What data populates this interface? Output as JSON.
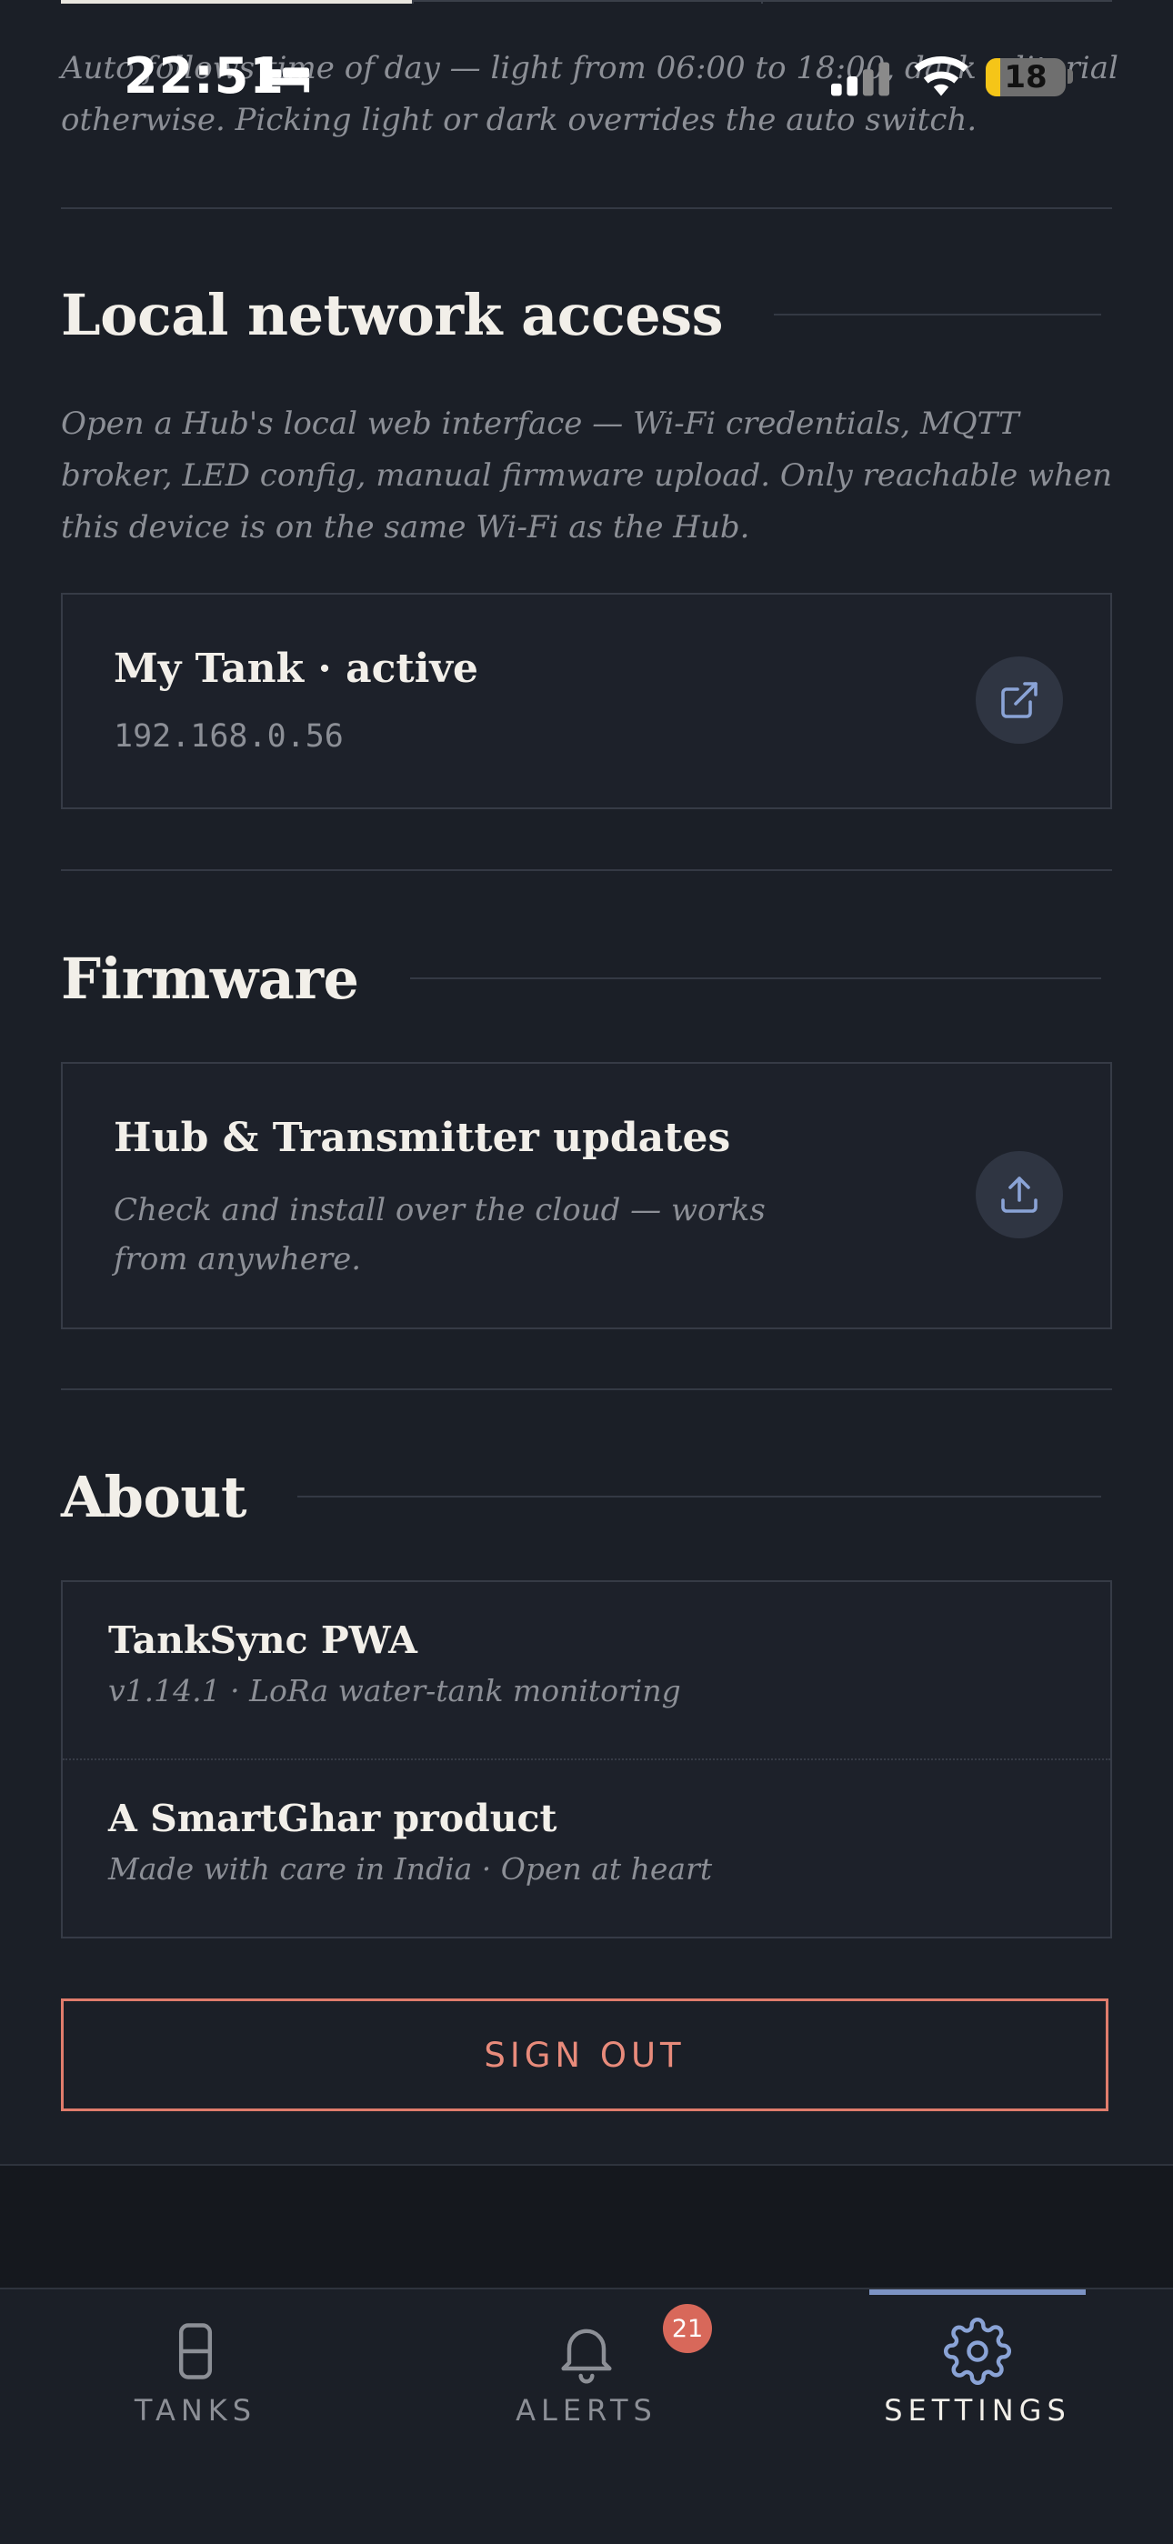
{
  "status_bar": {
    "time": "22:51",
    "battery_level": "18",
    "battery_fraction": 0.18,
    "icons": [
      "bed-icon",
      "cellular-signal-icon",
      "wifi-icon",
      "battery-icon"
    ]
  },
  "theme_note": "Auto follows time of day — light from 06:00 to 18:00, dark editorial otherwise. Picking light or dark overrides the auto switch.",
  "local_network": {
    "heading": "Local network access",
    "description": "Open a Hub's local web interface — Wi-Fi credentials, MQTT broker, LED config, manual firmware upload. Only reachable when this device is on the same Wi-Fi as the Hub.",
    "device": {
      "name": "My Tank · active",
      "ip": "192.168.0.56",
      "icon": "external-link-icon"
    }
  },
  "firmware": {
    "heading": "Firmware",
    "card_title": "Hub & Transmitter updates",
    "card_subtitle": "Check and install over the cloud — works from anywhere.",
    "icon": "upload-icon"
  },
  "about": {
    "heading": "About",
    "rows": [
      {
        "title": "TankSync PWA",
        "subtitle": "v1.14.1 · LoRa water-tank monitoring"
      },
      {
        "title": "A SmartGhar product",
        "subtitle": "Made with care in India · Open at heart"
      }
    ]
  },
  "sign_out_label": "SIGN OUT",
  "tabs": [
    {
      "label": "TANKS",
      "icon": "tank-icon"
    },
    {
      "label": "ALERTS",
      "icon": "bell-icon",
      "badge": "21"
    },
    {
      "label": "SETTINGS",
      "icon": "gear-icon",
      "active": true
    }
  ],
  "colors": {
    "background": "#1b1f27",
    "accent": "#7c93c4",
    "danger": "#e07c6c",
    "badge": "#d8685a"
  }
}
